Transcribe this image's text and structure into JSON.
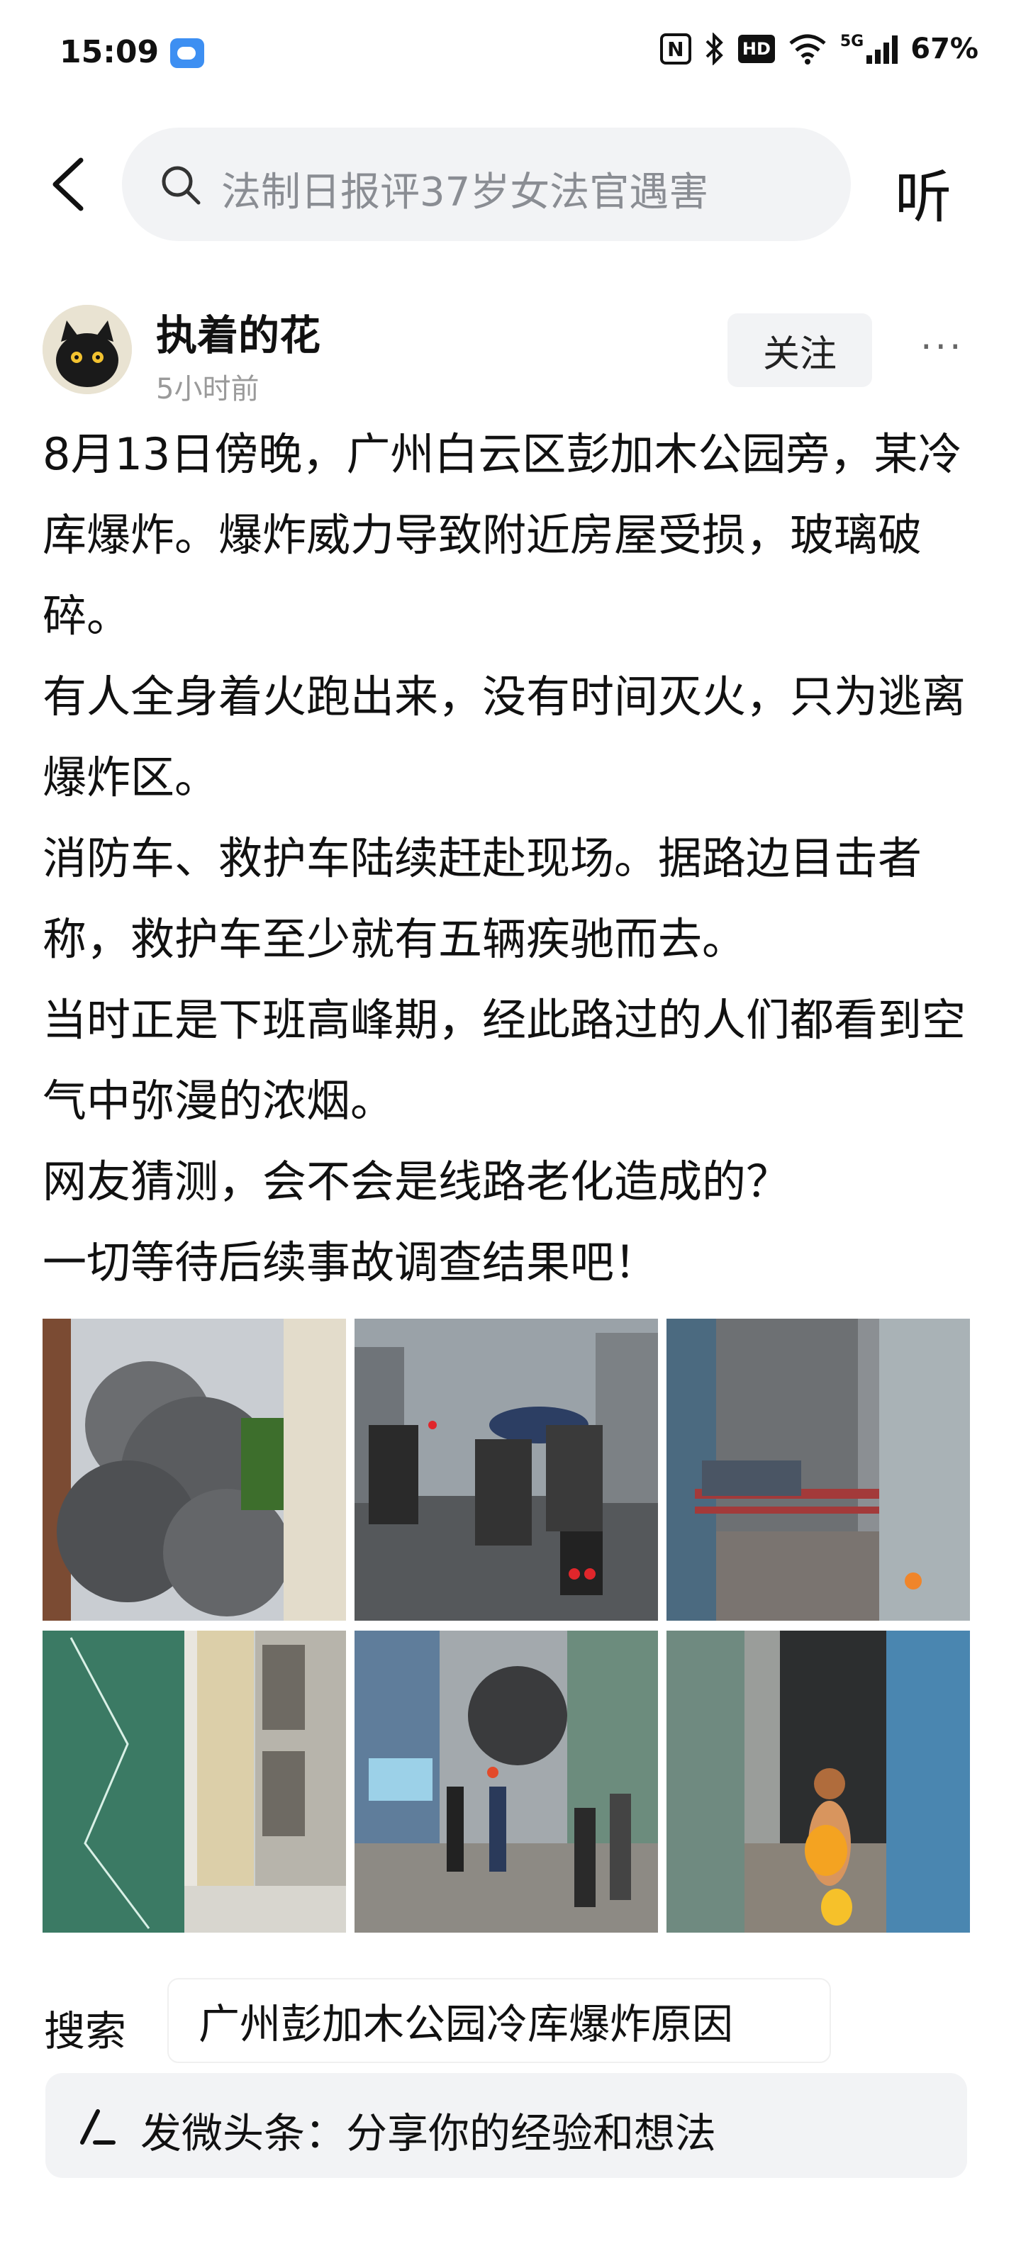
{
  "status_bar": {
    "time": "15:09",
    "network": "5G",
    "battery": "67%",
    "icons": [
      "weather-icon",
      "nfc-icon",
      "bluetooth-icon",
      "hd-icon",
      "wifi-icon",
      "signal-icon"
    ]
  },
  "search": {
    "back_icon": "back-chevron-icon",
    "query": "法制日报评37岁女法官遇害",
    "listen_label": "听"
  },
  "post": {
    "author": "执着的花",
    "time_ago": "5小时前",
    "follow_label": "关注",
    "more_label": "···",
    "paragraphs": [
      "8月13日傍晚，广州白云区彭加木公园旁，某冷库爆炸。爆炸威力导致附近房屋受损，玻璃破碎。",
      "有人全身着火跑出来，没有时间灭火，只为逃离爆炸区。",
      "消防车、救护车陆续赶赴现场。据路边目击者称，救护车至少就有五辆疾驰而去。",
      "当时正是下班高峰期，经此路过的人们都看到空气中弥漫的浓烟。",
      "网友猜测，会不会是线路老化造成的？",
      "一切等待后续事故调查结果吧！"
    ],
    "images": [
      "smoke-from-building",
      "street-traffic-scooters",
      "alley-smoke-burning-person",
      "cracked-window",
      "crowd-street-smoke",
      "burning-person-walking"
    ]
  },
  "search_suggest": {
    "label": "搜索",
    "query": "广州彭加木公园冷库爆炸原因"
  },
  "compose": {
    "placeholder": "发微头条：分享你的经验和想法"
  }
}
